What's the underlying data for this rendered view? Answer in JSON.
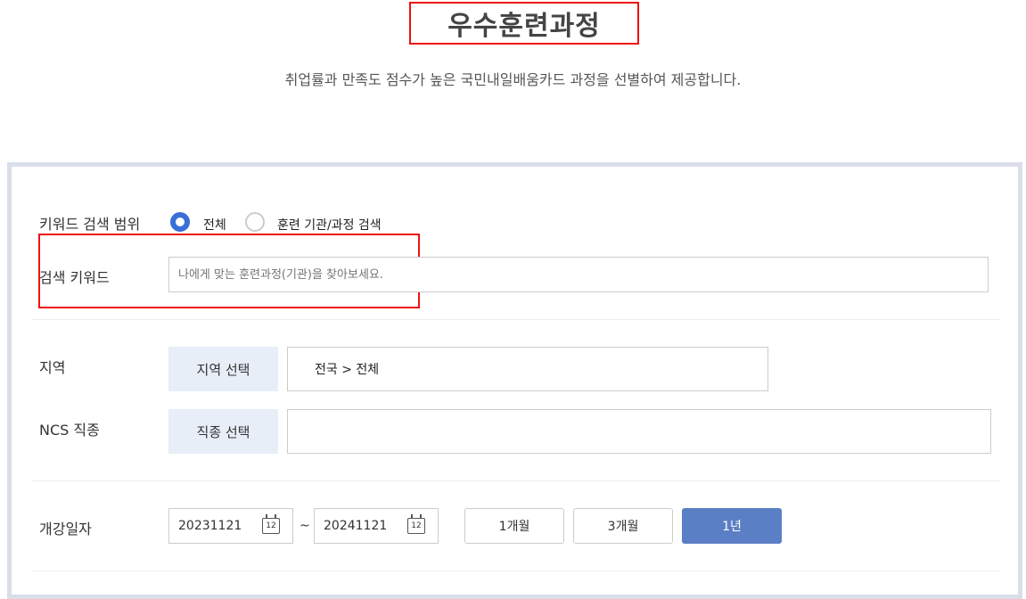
{
  "header": {
    "title": "우수훈련과정",
    "subtitle": "취업률과 만족도 점수가 높은 국민내일배움카드 과정을 선별하여 제공합니다."
  },
  "search": {
    "scope_label": "키워드 검색 범위",
    "scope_options": [
      "전체",
      "훈련 기관/과정 검색"
    ],
    "scope_selected": "전체",
    "keyword_label": "검색 키워드",
    "keyword_placeholder": "나에게 맞는 훈련과정(기관)을 찾아보세요.",
    "keyword_value": ""
  },
  "region": {
    "label": "지역",
    "button": "지역 선택",
    "value": "전국 > 전체"
  },
  "ncs": {
    "label": "NCS 직종",
    "button": "직종 선택",
    "value": ""
  },
  "date": {
    "label": "개강일자",
    "start": "20231121",
    "end": "20241121",
    "separator": "~",
    "calendar_icon_text": "12",
    "periods": [
      "1개월",
      "3개월",
      "1년"
    ],
    "active_period": "1년"
  },
  "colors": {
    "accent": "#3a6fd8",
    "active_button": "#5b7fc5",
    "select_button_bg": "#e7eef8",
    "highlight_box": "#ee1111",
    "panel_border": "#d9deea"
  }
}
